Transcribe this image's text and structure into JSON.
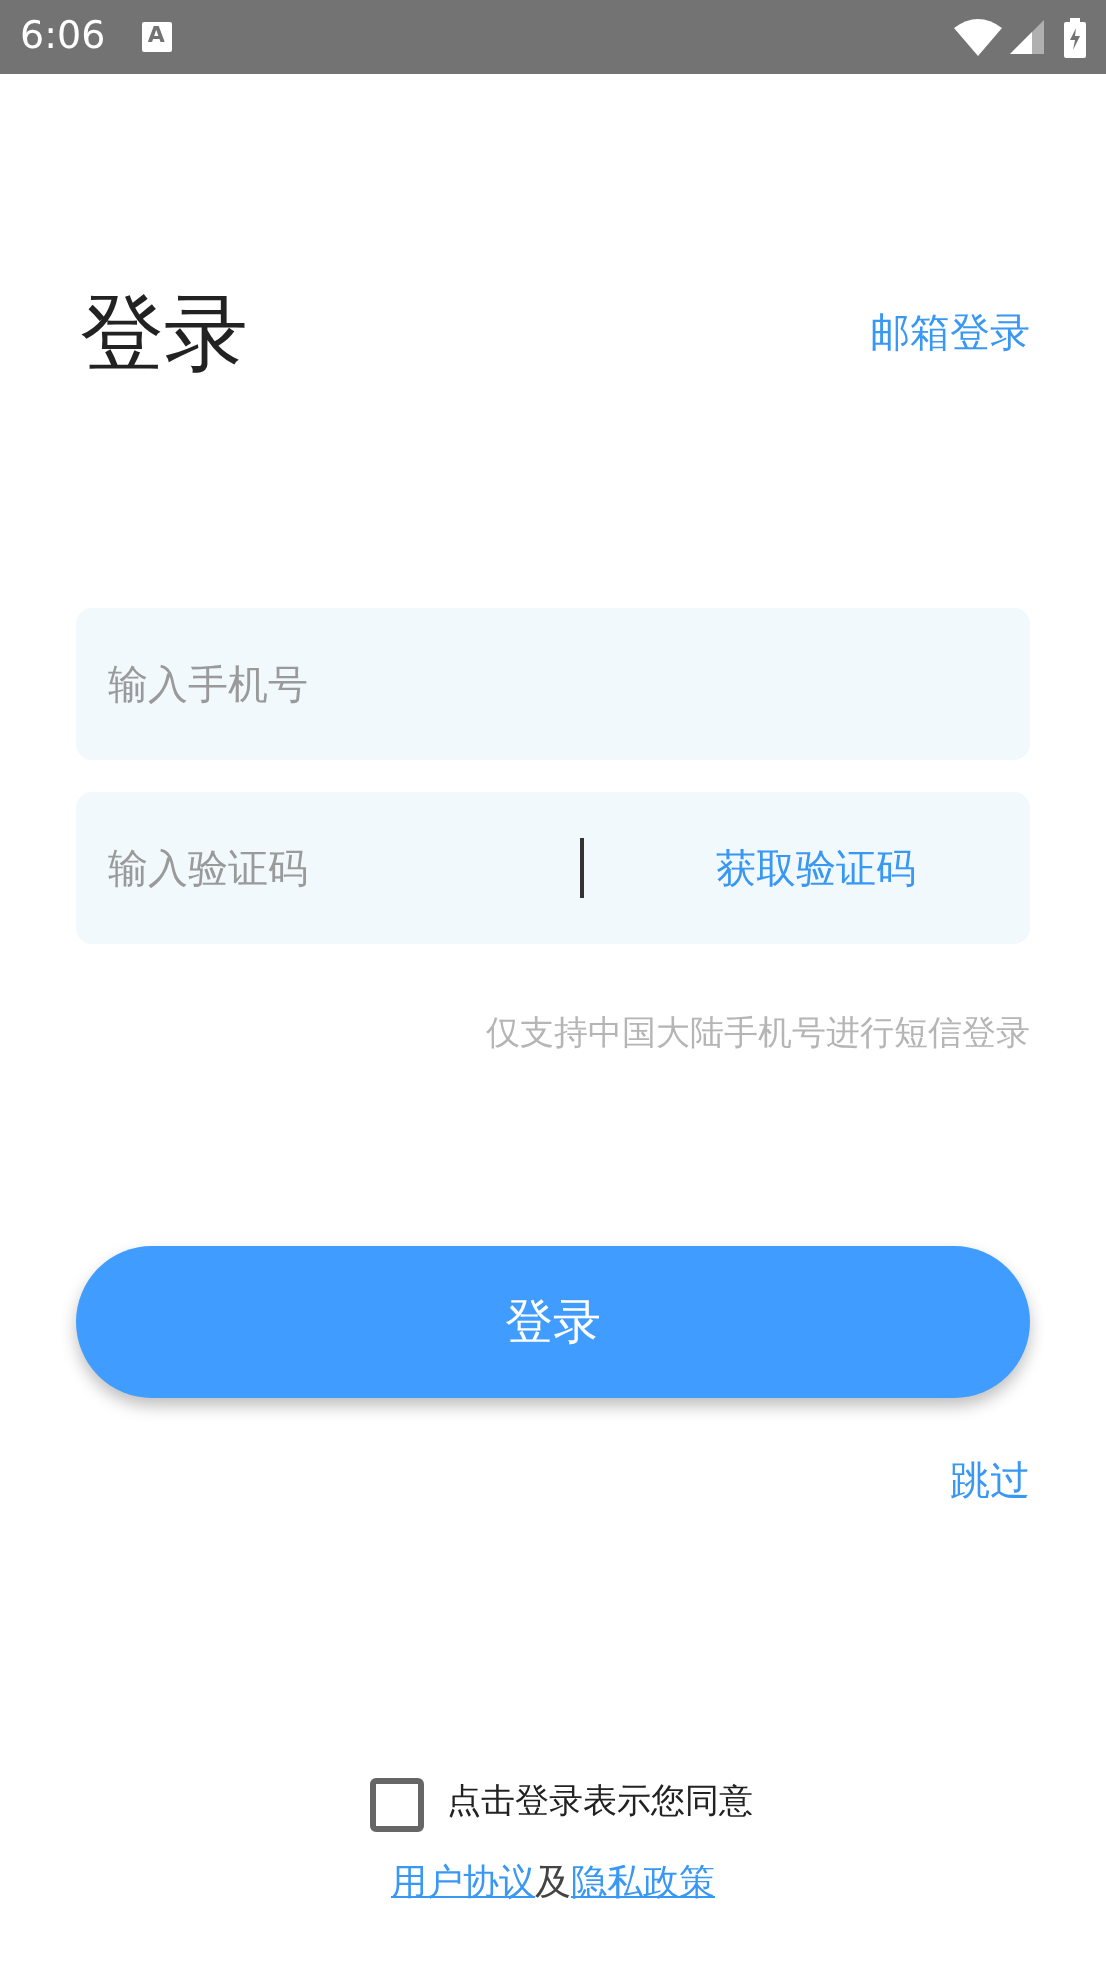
{
  "status_bar": {
    "time": "6:06",
    "keyboard_icon_letter": "A"
  },
  "title": "登录",
  "email_login_link": "邮箱登录",
  "phone_field": {
    "placeholder": "输入手机号"
  },
  "code_field": {
    "placeholder": "输入验证码"
  },
  "get_code_button": "获取验证码",
  "hint": "仅支持中国大陆手机号进行短信登录",
  "login_button": "登录",
  "skip_link": "跳过",
  "agreement": {
    "checked": false,
    "text": "点击登录表示您同意",
    "links": [
      {
        "kind": "link",
        "text": "用户协议"
      },
      {
        "kind": "plain",
        "text": "及"
      },
      {
        "kind": "link",
        "text": "隐私政策"
      }
    ]
  }
}
